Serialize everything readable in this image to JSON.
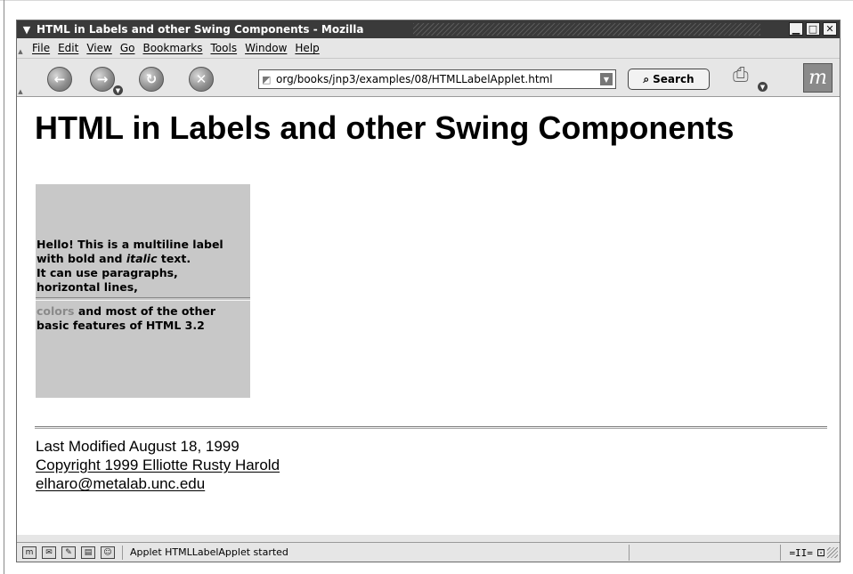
{
  "window": {
    "title": "HTML in Labels and other Swing Components - Mozilla",
    "menu_icon": "chevron-down-icon",
    "minimize": "▁",
    "maximize": "□",
    "close": "✕"
  },
  "menubar": {
    "items": [
      "File",
      "Edit",
      "View",
      "Go",
      "Bookmarks",
      "Tools",
      "Window",
      "Help"
    ]
  },
  "toolbar": {
    "back_icon": "back-arrow-icon",
    "forward_icon": "forward-arrow-icon",
    "reload_icon": "reload-icon",
    "stop_icon": "stop-icon",
    "url": "org/books/jnp3/examples/08/HTMLLabelApplet.html",
    "search_label": "Search"
  },
  "page": {
    "title": "HTML in Labels and other Swing Components",
    "applet": {
      "line1": "Hello! This is a multiline label",
      "line2_pre": "with bold and ",
      "line2_italic": "italic",
      "line2_post": " text.",
      "line3": "It can use paragraphs,",
      "line4": "horizontal lines,",
      "line5_colored": "colors",
      "line5_rest": " and most of the other",
      "line6": "basic features of HTML 3.2",
      "background": "#c8c8c8",
      "colored_word_color": "#8a8a8a"
    },
    "footer": {
      "modified": "Last Modified August 18, 1999",
      "copyright": "Copyright 1999 Elliotte Rusty Harold",
      "email": "elharo@metalab.unc.edu"
    }
  },
  "statusbar": {
    "text": "Applet HTMLLabelApplet started",
    "icons": [
      "mozilla-icon",
      "mail-icon",
      "composer-icon",
      "address-book-icon",
      "chat-icon"
    ]
  }
}
